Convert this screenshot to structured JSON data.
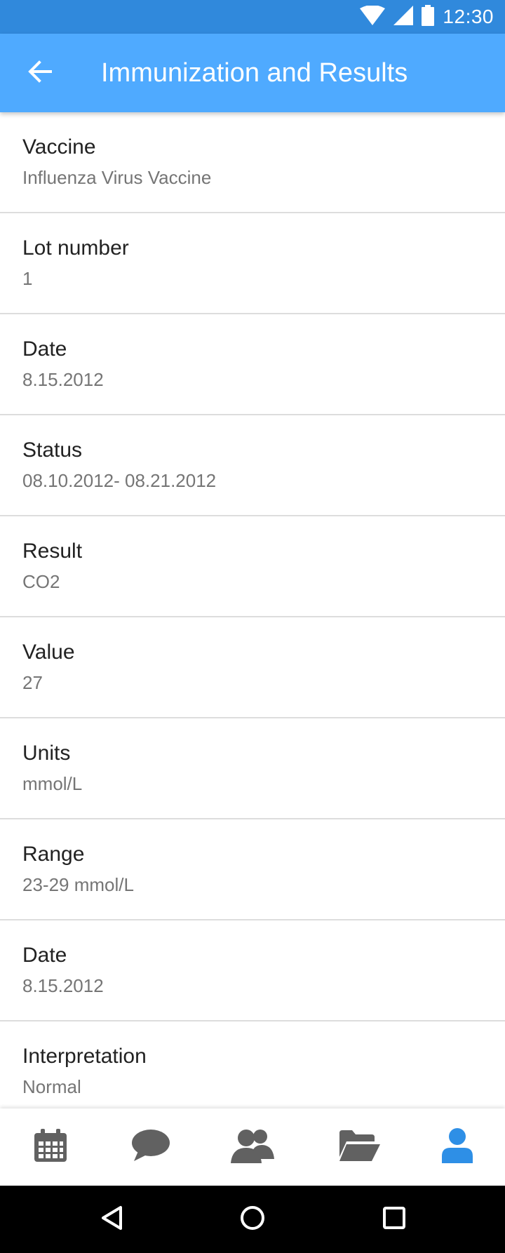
{
  "status_bar": {
    "time": "12:30",
    "icons": [
      "wifi-icon",
      "cellular-signal-icon",
      "battery-icon"
    ]
  },
  "app_bar": {
    "title": "Immunization and Results",
    "back_icon": "arrow-back-icon"
  },
  "fields": [
    {
      "label": "Vaccine",
      "value": "Influenza Virus Vaccine"
    },
    {
      "label": "Lot number",
      "value": "1"
    },
    {
      "label": "Date",
      "value": "8.15.2012"
    },
    {
      "label": "Status",
      "value": "08.10.2012- 08.21.2012"
    },
    {
      "label": "Result",
      "value": "CO2"
    },
    {
      "label": "Value",
      "value": "27"
    },
    {
      "label": "Units",
      "value": "mmol/L"
    },
    {
      "label": "Range",
      "value": "23-29 mmol/L"
    },
    {
      "label": "Date",
      "value": "8.15.2012"
    },
    {
      "label": "Interpretation",
      "value": "Normal"
    }
  ],
  "bottom_nav": {
    "items": [
      "calendar-icon",
      "chat-icon",
      "contacts-icon",
      "folder-icon",
      "profile-icon"
    ],
    "active": "profile-icon",
    "active_color": "#2e8fe6",
    "inactive_color": "#616161"
  },
  "system_nav": [
    "back-triangle-icon",
    "home-circle-icon",
    "recents-square-icon"
  ],
  "colors": {
    "status_bar": "#3089dc",
    "app_bar": "#4faaff",
    "divider": "#dddddd"
  }
}
